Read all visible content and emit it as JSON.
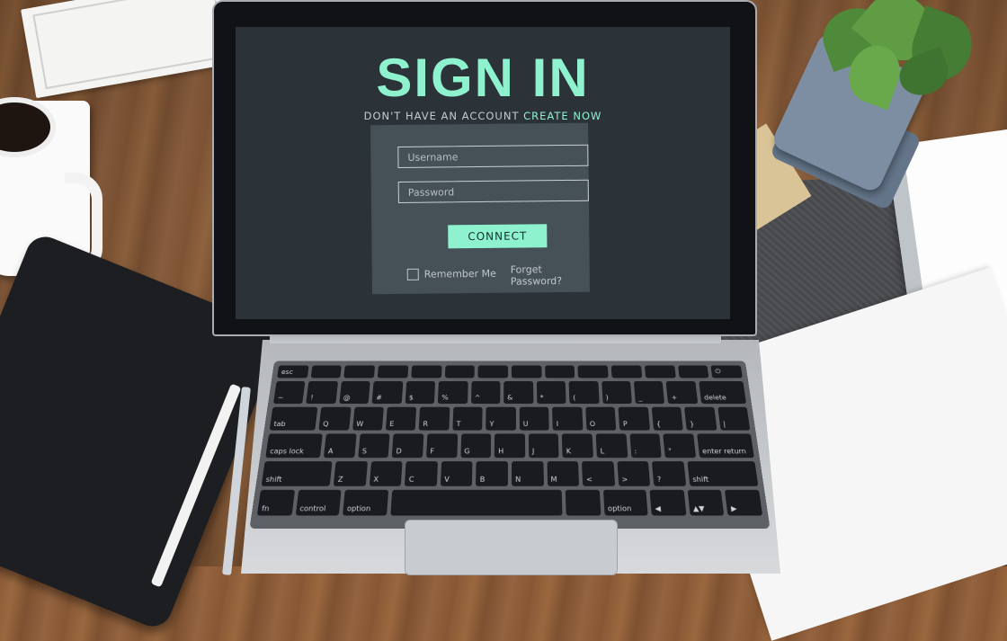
{
  "colors": {
    "accent": "#8ef2cf",
    "screen_bg": "#2c3338",
    "panel_bg": "#465057",
    "text_muted": "#c4ccd1"
  },
  "signin": {
    "title": "SIGN IN",
    "prompt": "DON'T HAVE AN ACCOUNT",
    "create_link": "CREATE NOW",
    "username_placeholder": "Username",
    "password_placeholder": "Password",
    "connect_label": "CONNECT",
    "remember_label": "Remember Me",
    "forgot_label": "Forget Password?"
  },
  "keyboard": {
    "fn_row": [
      "esc",
      "",
      "",
      "",
      "",
      "",
      "",
      "",
      "",
      "",
      "",
      "",
      "",
      "⏻"
    ],
    "row1": [
      "~",
      "!",
      "@",
      "#",
      "$",
      "%",
      "^",
      "&",
      "*",
      "(",
      ")",
      "_",
      "+",
      "delete"
    ],
    "row2": [
      "tab",
      "Q",
      "W",
      "E",
      "R",
      "T",
      "Y",
      "U",
      "I",
      "O",
      "P",
      "{",
      "}",
      "|"
    ],
    "row3": [
      "caps lock",
      "A",
      "S",
      "D",
      "F",
      "G",
      "H",
      "J",
      "K",
      "L",
      ":",
      "\"",
      "enter return"
    ],
    "row4": [
      "shift",
      "Z",
      "X",
      "C",
      "V",
      "B",
      "N",
      "M",
      "<",
      ">",
      "?",
      "shift"
    ],
    "row5": [
      "fn",
      "control",
      "option",
      "",
      "",
      "option",
      "◀",
      "▲▼",
      "▶"
    ]
  }
}
